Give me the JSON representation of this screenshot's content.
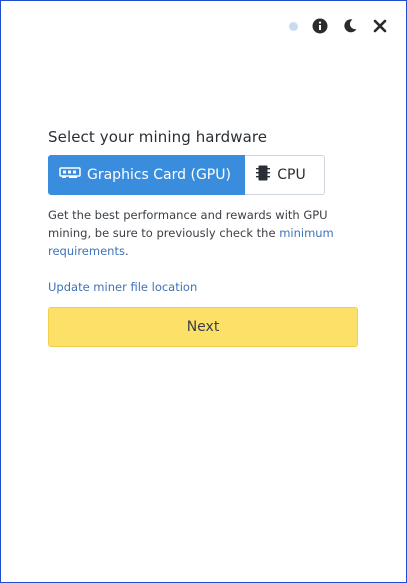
{
  "header": {
    "status_icon": "status-dot",
    "info_icon": "info-icon",
    "theme_icon": "moon-icon",
    "close_icon": "close-icon"
  },
  "main": {
    "title": "Select your mining hardware",
    "options": [
      {
        "label": "Graphics Card (GPU)",
        "icon": "gpu-card-icon",
        "selected": true
      },
      {
        "label": "CPU",
        "icon": "cpu-chip-icon",
        "selected": false
      }
    ],
    "description": {
      "text": "Get the best performance and rewards with GPU mining, be sure to previously check the ",
      "link": "minimum requirements",
      "end": "."
    },
    "update_link": "Update miner file location",
    "next_button": "Next"
  },
  "colors": {
    "accent": "#3a8ddc",
    "next_button": "#fde068",
    "link": "#3d73b8",
    "window_border": "#1f4fd0"
  }
}
